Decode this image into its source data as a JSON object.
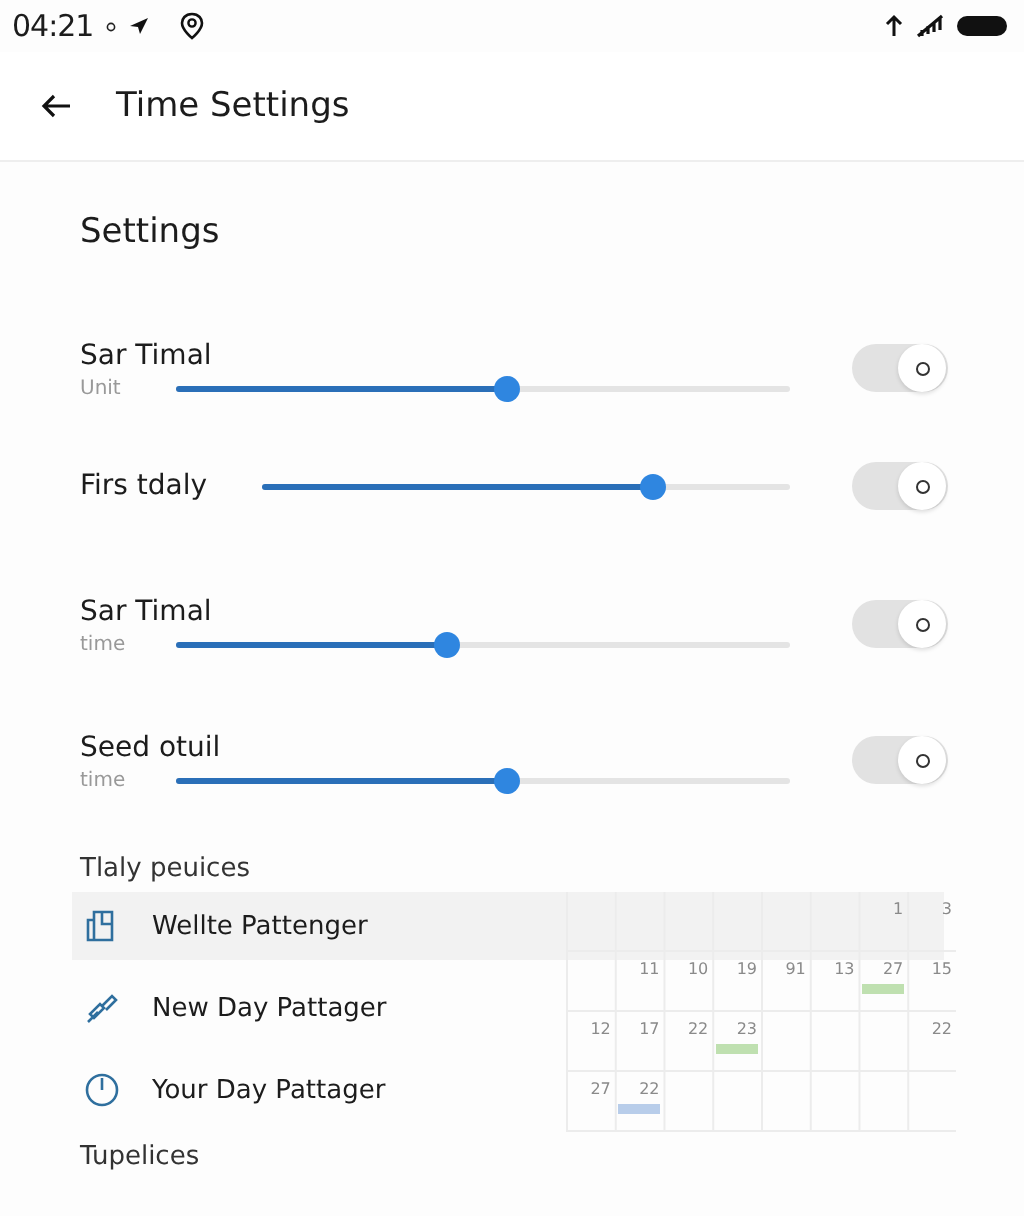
{
  "status_bar": {
    "time": "04:21"
  },
  "app_bar": {
    "title": "Time Settings"
  },
  "section_title": "Settings",
  "settings": [
    {
      "kind": "stacked",
      "title": "Sar Timal",
      "caption": "Unit",
      "level": 0.54,
      "on": true
    },
    {
      "kind": "inline",
      "title": "Firs tdaly",
      "level": 0.74,
      "on": true
    },
    {
      "kind": "stacked",
      "title": "Sar Timal",
      "caption": "time",
      "level": 0.44,
      "on": true
    },
    {
      "kind": "stacked",
      "title": "Seed otuil",
      "caption": "time",
      "level": 0.54,
      "on": true
    }
  ],
  "list_title": "Tlaly peuices",
  "patterns": [
    {
      "kind": "tile",
      "label": "Wellte Pattenger",
      "selected": true
    },
    {
      "kind": "pin",
      "label": "New Day Pattager",
      "selected": false
    },
    {
      "kind": "power",
      "label": "Your Day Pattager",
      "selected": false
    }
  ],
  "calendar": {
    "weeks": [
      {
        "end": [
          {
            "date": "1"
          },
          {
            "date": "3"
          }
        ]
      },
      {
        "end": [
          {
            "date": "11"
          },
          {
            "date": "10"
          },
          {
            "date": "19"
          },
          {
            "date": "91"
          },
          {
            "date": "13"
          },
          {
            "date": "27",
            "color": "#bfe0b0"
          },
          {
            "date": "15"
          }
        ]
      },
      {
        "start": [
          {
            "date": "12"
          },
          {
            "date": "17"
          },
          {
            "date": "22"
          },
          {
            "date": "23",
            "color": "#bfe0b0"
          }
        ],
        "end": [
          {
            "date": "22"
          }
        ]
      },
      {
        "start": [
          {
            "date": "27"
          },
          {
            "date": "22",
            "color": "#b8cdea"
          }
        ]
      }
    ]
  },
  "footer_title": "Tupelices"
}
